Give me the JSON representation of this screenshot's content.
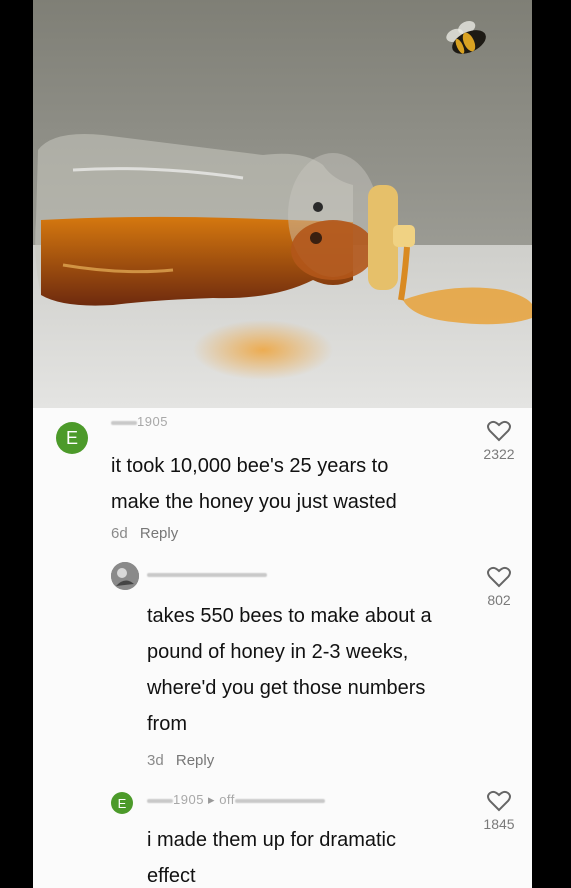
{
  "painting": {
    "subject": "honey bear bottle spilling honey with a bee",
    "colors": {
      "wall": "#8e8e85",
      "table": "#d9d9d6",
      "honey": "#c86a12"
    }
  },
  "comments": [
    {
      "avatar_letter": "E",
      "username": "1905",
      "text_line1": "it took 10,000 bee's 25 years to",
      "text_line2": "make the honey you just wasted",
      "age": "6d",
      "reply_label": "Reply",
      "likes": "2322"
    },
    {
      "avatar_letter": "",
      "username": "",
      "text_line1": "takes 550 bees to make about a",
      "text_line2": "pound of honey in 2-3 weeks,",
      "text_line3": "where'd you get those numbers",
      "text_line4": "from",
      "age": "3d",
      "reply_label": "Reply",
      "likes": "802"
    },
    {
      "avatar_letter": "E",
      "username": "1905",
      "reply_to": "off",
      "text_line1": "i made them up for dramatic",
      "text_line2": "effect",
      "likes": "1845"
    }
  ]
}
